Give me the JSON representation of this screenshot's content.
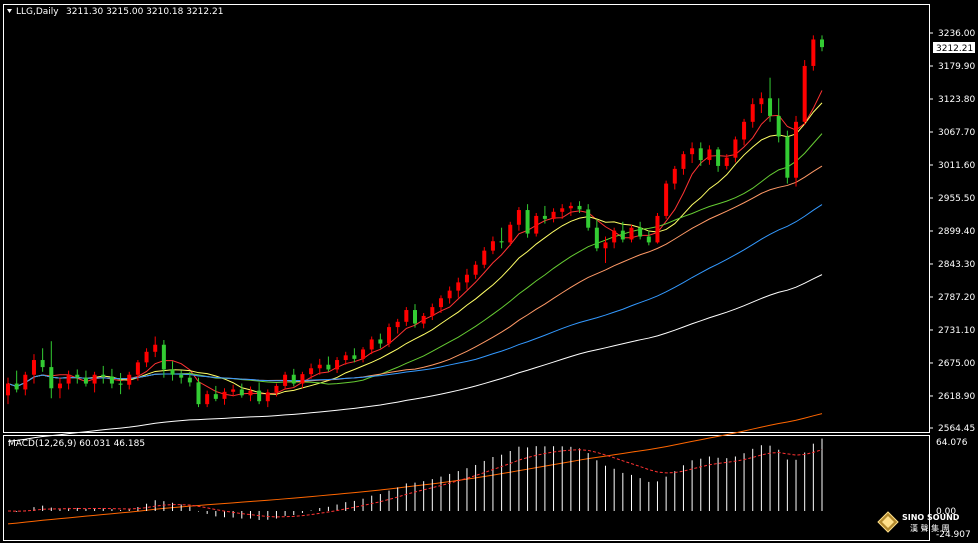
{
  "header": {
    "title": "LLG,Daily",
    "ohlc": "3211.30 3215.00 3210.18 3212.21"
  },
  "current_price_label": "3212.21",
  "macd": {
    "label": "MACD(12,26,9) 60.031 46.185",
    "y_ticks": [
      "64.076",
      "0.00",
      "-24.907"
    ]
  },
  "watermark": {
    "brand": "SINO SOUND",
    "sub": "漢 聲 集 團"
  },
  "colors": {
    "up": "#ff0000",
    "down": "#33cc33",
    "ma5": "#ff3333",
    "ma10": "#ffff66",
    "ma20": "#66cc33",
    "ma30": "#ff9966",
    "ma60": "#3399ff",
    "ma120": "#ffffff",
    "ma250": "#ff6600",
    "macd_hist": "#ffffff",
    "macd_signal": "#ff3333"
  },
  "chart_data": {
    "type": "candlestick",
    "price_axis": {
      "ticks": [
        "3236.00",
        "3179.90",
        "3123.80",
        "3067.70",
        "3011.60",
        "2955.50",
        "2899.40",
        "2843.30",
        "2787.20",
        "2731.10",
        "2675.00",
        "2618.90",
        "2564.45"
      ],
      "ylim": [
        2564.45,
        3236.0
      ]
    },
    "candles": [
      [
        2620,
        2650,
        2605,
        2640
      ],
      [
        2640,
        2662,
        2625,
        2630
      ],
      [
        2630,
        2660,
        2620,
        2655
      ],
      [
        2655,
        2690,
        2640,
        2680
      ],
      [
        2680,
        2700,
        2660,
        2668
      ],
      [
        2668,
        2712,
        2615,
        2632
      ],
      [
        2632,
        2650,
        2615,
        2640
      ],
      [
        2640,
        2662,
        2630,
        2655
      ],
      [
        2655,
        2664,
        2640,
        2650
      ],
      [
        2650,
        2662,
        2635,
        2640
      ],
      [
        2640,
        2660,
        2625,
        2655
      ],
      [
        2655,
        2670,
        2640,
        2652
      ],
      [
        2652,
        2665,
        2632,
        2640
      ],
      [
        2640,
        2658,
        2622,
        2638
      ],
      [
        2638,
        2660,
        2630,
        2655
      ],
      [
        2655,
        2680,
        2645,
        2676
      ],
      [
        2676,
        2700,
        2668,
        2694
      ],
      [
        2694,
        2720,
        2685,
        2706
      ],
      [
        2706,
        2714,
        2650,
        2664
      ],
      [
        2664,
        2678,
        2645,
        2655
      ],
      [
        2655,
        2662,
        2640,
        2650
      ],
      [
        2650,
        2660,
        2635,
        2642
      ],
      [
        2642,
        2650,
        2600,
        2605
      ],
      [
        2605,
        2628,
        2600,
        2622
      ],
      [
        2622,
        2636,
        2610,
        2614
      ],
      [
        2614,
        2632,
        2604,
        2626
      ],
      [
        2626,
        2638,
        2618,
        2630
      ],
      [
        2630,
        2640,
        2616,
        2620
      ],
      [
        2620,
        2635,
        2610,
        2628
      ],
      [
        2628,
        2642,
        2605,
        2610
      ],
      [
        2610,
        2630,
        2600,
        2625
      ],
      [
        2625,
        2640,
        2618,
        2636
      ],
      [
        2636,
        2660,
        2630,
        2655
      ],
      [
        2655,
        2665,
        2635,
        2640
      ],
      [
        2640,
        2660,
        2632,
        2656
      ],
      [
        2656,
        2674,
        2648,
        2666
      ],
      [
        2666,
        2682,
        2655,
        2672
      ],
      [
        2672,
        2686,
        2660,
        2664
      ],
      [
        2664,
        2685,
        2658,
        2680
      ],
      [
        2680,
        2694,
        2672,
        2688
      ],
      [
        2688,
        2700,
        2676,
        2682
      ],
      [
        2682,
        2702,
        2676,
        2698
      ],
      [
        2698,
        2720,
        2690,
        2715
      ],
      [
        2715,
        2725,
        2700,
        2708
      ],
      [
        2708,
        2742,
        2702,
        2736
      ],
      [
        2736,
        2750,
        2725,
        2745
      ],
      [
        2745,
        2770,
        2738,
        2765
      ],
      [
        2765,
        2775,
        2735,
        2742
      ],
      [
        2742,
        2760,
        2734,
        2755
      ],
      [
        2755,
        2776,
        2748,
        2770
      ],
      [
        2770,
        2790,
        2760,
        2785
      ],
      [
        2785,
        2805,
        2776,
        2798
      ],
      [
        2798,
        2820,
        2786,
        2812
      ],
      [
        2812,
        2835,
        2800,
        2825
      ],
      [
        2825,
        2848,
        2818,
        2842
      ],
      [
        2842,
        2872,
        2836,
        2866
      ],
      [
        2866,
        2890,
        2860,
        2882
      ],
      [
        2882,
        2905,
        2870,
        2880
      ],
      [
        2880,
        2915,
        2874,
        2910
      ],
      [
        2910,
        2940,
        2900,
        2935
      ],
      [
        2935,
        2945,
        2888,
        2895
      ],
      [
        2895,
        2930,
        2890,
        2925
      ],
      [
        2925,
        2942,
        2912,
        2920
      ],
      [
        2920,
        2938,
        2914,
        2932
      ],
      [
        2932,
        2945,
        2920,
        2938
      ],
      [
        2938,
        2948,
        2925,
        2942
      ],
      [
        2942,
        2950,
        2930,
        2936
      ],
      [
        2936,
        2945,
        2900,
        2905
      ],
      [
        2905,
        2920,
        2865,
        2870
      ],
      [
        2870,
        2890,
        2845,
        2880
      ],
      [
        2880,
        2905,
        2870,
        2900
      ],
      [
        2900,
        2915,
        2880,
        2885
      ],
      [
        2885,
        2910,
        2880,
        2905
      ],
      [
        2905,
        2915,
        2885,
        2890
      ],
      [
        2890,
        2900,
        2875,
        2880
      ],
      [
        2880,
        2930,
        2878,
        2925
      ],
      [
        2925,
        2985,
        2920,
        2980
      ],
      [
        2980,
        3010,
        2970,
        3005
      ],
      [
        3005,
        3035,
        2995,
        3030
      ],
      [
        3030,
        3050,
        3015,
        3040
      ],
      [
        3040,
        3050,
        3010,
        3020
      ],
      [
        3020,
        3045,
        3012,
        3038
      ],
      [
        3038,
        3042,
        3000,
        3010
      ],
      [
        3010,
        3030,
        3004,
        3024
      ],
      [
        3024,
        3060,
        3016,
        3055
      ],
      [
        3055,
        3090,
        3045,
        3085
      ],
      [
        3085,
        3125,
        3075,
        3115
      ],
      [
        3115,
        3135,
        3100,
        3125
      ],
      [
        3125,
        3160,
        3085,
        3095
      ],
      [
        3095,
        3125,
        3050,
        3060
      ],
      [
        3060,
        3070,
        2980,
        2990
      ],
      [
        2990,
        3095,
        2975,
        3085
      ],
      [
        3085,
        3190,
        3080,
        3180
      ],
      [
        3180,
        3232,
        3172,
        3225
      ],
      [
        3225,
        3232,
        3205,
        3212
      ]
    ]
  }
}
